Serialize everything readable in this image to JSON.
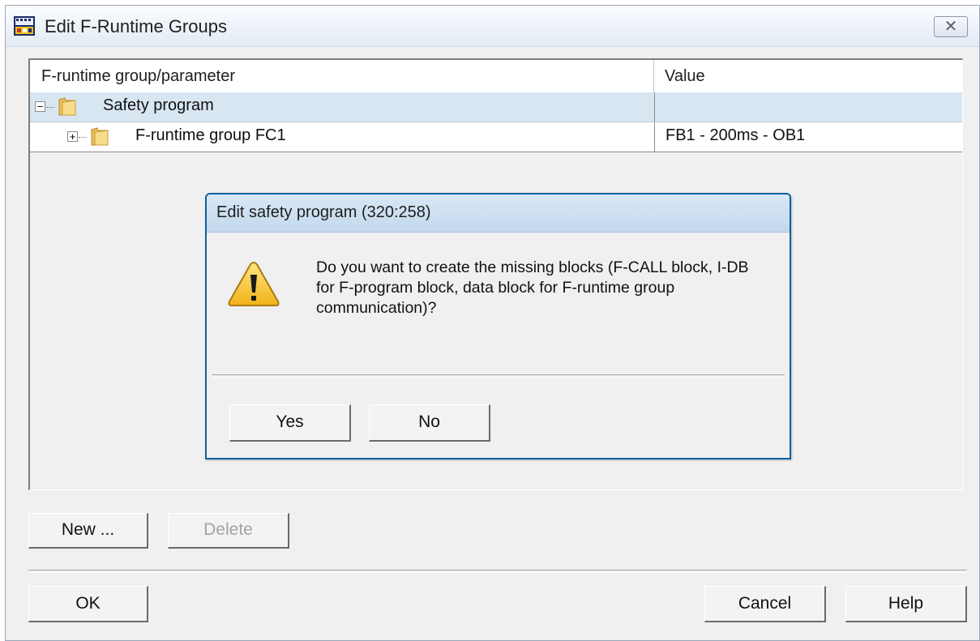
{
  "window": {
    "title": "Edit F-Runtime Groups",
    "close_glyph": "✕"
  },
  "tree": {
    "columns": [
      "F-runtime group/parameter",
      "Value"
    ],
    "rows": [
      {
        "expander": "−",
        "icon": "folder-icon",
        "label": "Safety program",
        "value": "",
        "selected": true
      },
      {
        "expander": "+",
        "icon": "folder-icon",
        "label": "F-runtime group FC1",
        "value": "FB1 - 200ms - OB1",
        "selected": false
      }
    ]
  },
  "buttons": {
    "new": "New ...",
    "delete": "Delete",
    "ok": "OK",
    "cancel": "Cancel",
    "help": "Help"
  },
  "dialog": {
    "title": "Edit safety program (320:258)",
    "message": "Do you want to create the missing blocks (F-CALL block, I-DB for F-program block, data block for F-runtime group communication)?",
    "icon": "warning-icon",
    "yes": "Yes",
    "no": "No"
  },
  "colors": {
    "selected_row": "#d8e6f2",
    "dialog_border": "#0e5f9c",
    "disabled_text": "#a3a3a3"
  }
}
